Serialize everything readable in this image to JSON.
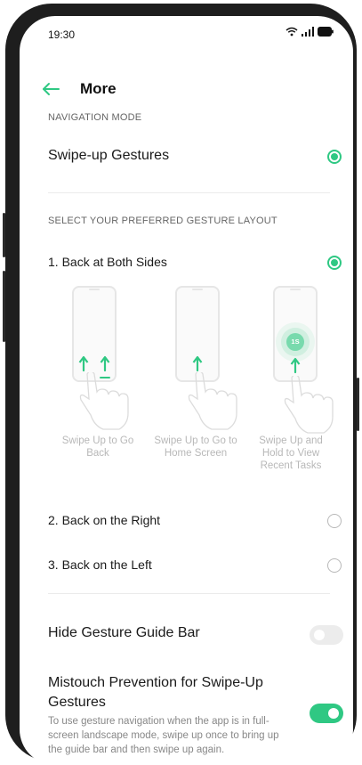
{
  "status_bar": {
    "time": "19:30",
    "icons": [
      "wifi-icon",
      "signal-icon",
      "battery-icon"
    ]
  },
  "header": {
    "title": "More",
    "back_icon": "arrow-left-icon"
  },
  "navigation_mode": {
    "section_label": "NAVIGATION MODE",
    "option_label": "Swipe-up Gestures",
    "selected": true
  },
  "gesture_layout": {
    "section_label": "SELECT YOUR PREFERRED GESTURE LAYOUT",
    "options": [
      {
        "label": "1. Back at Both Sides",
        "selected": true
      },
      {
        "label": "2. Back on the Right",
        "selected": false
      },
      {
        "label": "3. Back on the Left",
        "selected": false
      }
    ],
    "illustrations": [
      {
        "caption": "Swipe Up to Go Back"
      },
      {
        "caption": "Swipe Up to Go to Home Screen"
      },
      {
        "caption": "Swipe Up and Hold to View Recent Tasks",
        "badge": "1S"
      }
    ]
  },
  "settings": {
    "hide_gesture_guide_bar": {
      "label": "Hide Gesture Guide Bar",
      "enabled": false
    },
    "mistouch_prevention": {
      "label": "Mistouch Prevention for Swipe-Up Gestures",
      "description": "To use gesture navigation when the app is in full-screen landscape mode, swipe up once to bring up the guide bar and then swipe up again.",
      "enabled": true
    }
  },
  "colors": {
    "accent": "#2fc883",
    "text": "#1a1a1a",
    "muted": "#666666",
    "caption": "#b8b8b8"
  }
}
